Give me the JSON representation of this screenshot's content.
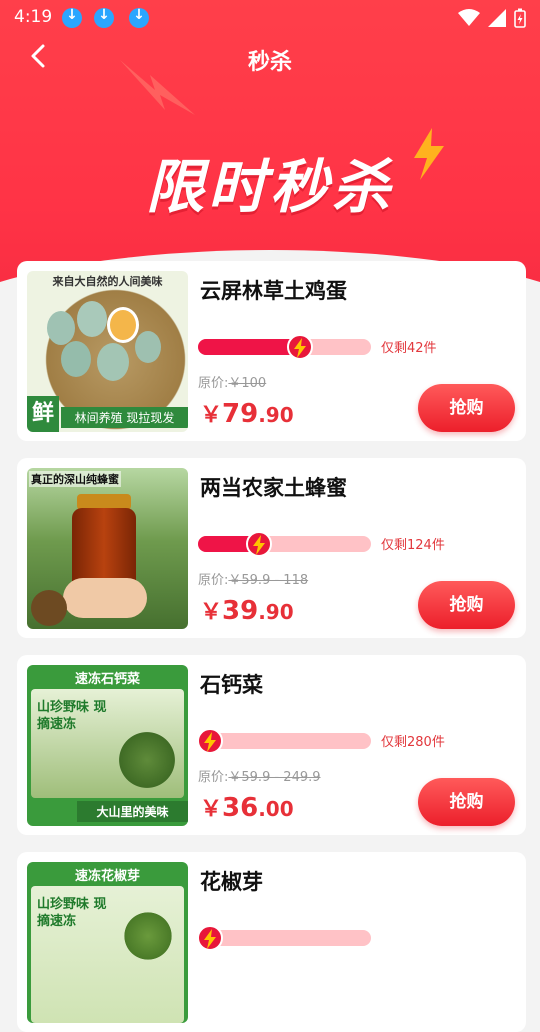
{
  "status_bar": {
    "time": "4:19"
  },
  "header": {
    "title": "秒杀"
  },
  "banner": {
    "text": "限时秒杀"
  },
  "colors": {
    "primary": "#ff3346",
    "price": "#e73038",
    "progress_fill": "#ef1447",
    "progress_track": "#ffc2c6",
    "download_badge": "#2aa6ff"
  },
  "products": [
    {
      "name": "云屏林草土鸡蛋",
      "remaining": "仅剩42件",
      "progress": 0.6,
      "orig_label": "原价:",
      "orig_price": "￥100",
      "currency": "￥",
      "price_int": "79",
      "price_dec": ".90",
      "buy": "抢购",
      "thumb_top": "来自大自然的人间美味",
      "thumb_bottom": "林间养殖 现拉现发",
      "thumb_badge": "鲜"
    },
    {
      "name": "两当农家土蜂蜜",
      "remaining": "仅剩124件",
      "progress": 0.36,
      "orig_label": "原价:",
      "orig_price": "￥59.9 - 118",
      "currency": "￥",
      "price_int": "39",
      "price_dec": ".90",
      "buy": "抢购",
      "thumb_top": "真正的深山纯蜂蜜",
      "thumb_bottom": "",
      "thumb_badge": ""
    },
    {
      "name": "石钙菜",
      "remaining": "仅剩280件",
      "progress": 0.06,
      "orig_label": "原价:",
      "orig_price": "￥59.9 - 249.9",
      "currency": "￥",
      "price_int": "36",
      "price_dec": ".00",
      "buy": "抢购",
      "thumb_top": "速冻石钙菜",
      "thumb_bottom": "大山里的美味",
      "thumb_badge": "山珍野味 现摘速冻"
    },
    {
      "name": "花椒芽",
      "remaining": "",
      "progress": 0.06,
      "orig_label": "",
      "orig_price": "",
      "currency": "",
      "price_int": "",
      "price_dec": "",
      "buy": "",
      "thumb_top": "速冻花椒芽",
      "thumb_bottom": "",
      "thumb_badge": "山珍野味 现摘速冻"
    }
  ]
}
